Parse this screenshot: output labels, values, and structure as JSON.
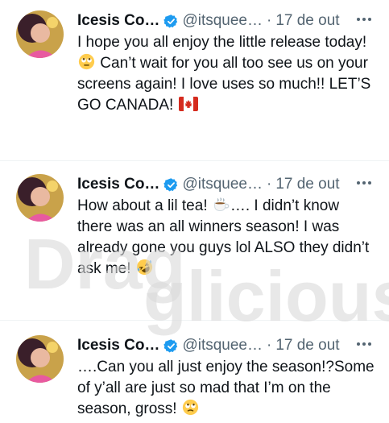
{
  "tweets": [
    {
      "display_name": "Icesis Co…",
      "handle": "@itsquee…",
      "separator": "·",
      "timestamp": "17 de out",
      "text_before_emoji": "I hope you all enjoy the little release today! ",
      "emoji": "rolling-eyes-emoji",
      "text_after_emoji": " Can’t wait for you all too see us on your screens again! I love uses so much!! LET’S GO CANADA! ",
      "trailing_emoji": "canada-flag-emoji"
    },
    {
      "display_name": "Icesis Co…",
      "handle": "@itsquee…",
      "separator": "·",
      "timestamp": "17 de out",
      "text_before_emoji": "How about a lil tea! ",
      "emoji": "hot-beverage-emoji",
      "text_after_emoji": "…. I didn’t know there was an all winners season! I was already gone you guys lol ALSO they didn’t ask me! ",
      "trailing_emoji": "rofl-emoji"
    },
    {
      "display_name": "Icesis Co…",
      "handle": "@itsquee…",
      "separator": "·",
      "timestamp": "17 de out",
      "text_before_emoji": "….Can you all just enjoy the season!?Some of y’all are just so mad that I’m on the season, gross! ",
      "emoji": "eye-roll-emoji",
      "text_after_emoji": "",
      "trailing_emoji": ""
    }
  ],
  "watermark": {
    "text": "Dragglicious",
    "first": "Drag",
    "second": "glicious"
  },
  "colors": {
    "verified": "#1d9bf0",
    "muted": "#536471",
    "text": "#0f1419",
    "divider": "#eff3f4"
  }
}
